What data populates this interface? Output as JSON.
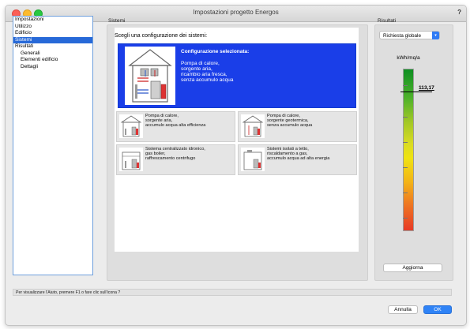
{
  "window": {
    "title": "Impostazioni progetto Energos",
    "help": "?"
  },
  "nav": {
    "items": [
      {
        "label": "Impostazioni",
        "sub": false,
        "selected": false
      },
      {
        "label": "Utilizzo",
        "sub": false,
        "selected": false
      },
      {
        "label": "Edificio",
        "sub": false,
        "selected": false
      },
      {
        "label": "Sistemi",
        "sub": false,
        "selected": true
      },
      {
        "label": "Risultati",
        "sub": false,
        "selected": false
      },
      {
        "label": "Generali",
        "sub": true,
        "selected": false
      },
      {
        "label": "Elementi edificio",
        "sub": true,
        "selected": false
      },
      {
        "label": "Dettagli",
        "sub": true,
        "selected": false
      }
    ]
  },
  "systems": {
    "section_label": "Sistemi",
    "prompt": "Scegli una configurazione dei sistemi:",
    "selected": {
      "heading": "Configurazione selezionata:",
      "description": "Pompa di calore,\nsorgente aria,\nricambio aria fresca,\nsenza accumulo acqua"
    },
    "options": [
      {
        "text": "Pompa di calore,\nsorgente aria,\naccumulo acqua alta efficienza"
      },
      {
        "text": "Pompa di calore,\nsorgente geotermica,\nsenza accumulo acqua"
      },
      {
        "text": "Sistema centralizzato idronico,\ngas boiler,\nraffrescamento centrifugo"
      },
      {
        "text": "Sistemi isolati a tetto,\nriscaldamento a gas,\naccumulo acqua ad alta energia"
      }
    ]
  },
  "results": {
    "section_label": "Risultati",
    "select_value": "Richiesta globale",
    "unit": "kWh/mq/a",
    "value": "113,17",
    "value_fraction": 0.14,
    "update_button": "Aggiorna"
  },
  "status": {
    "text": "Per visualizzare l'Aiuto, premere F1 o fare clic sull'icona ?"
  },
  "footer": {
    "cancel": "Annulla",
    "ok": "OK"
  },
  "colors": {
    "selection": "#2769d8",
    "selected_card": "#1a3ee8",
    "primary_button": "#2f83f6"
  }
}
